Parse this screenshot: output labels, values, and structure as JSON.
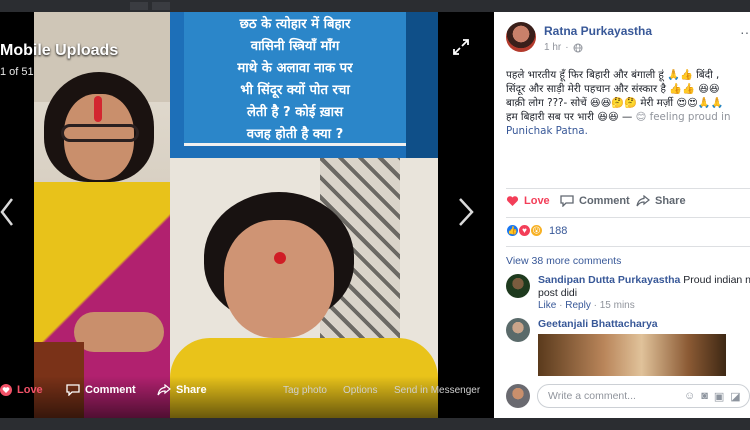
{
  "viewer": {
    "album_title": "Mobile Uploads",
    "counter": "1 of 51",
    "sign_lines": [
      "छठ के त्योहार में बिहार",
      "वासिनी स्त्रियाँ माँग",
      "माथे के अलावा नाक पर",
      "भी सिंदूर क्यों पोत रचा",
      "लेती है ? कोई ख़ास",
      "वजह होती है क्या ?"
    ],
    "actions": {
      "love": "Love",
      "comment": "Comment",
      "share": "Share"
    },
    "links": {
      "tag": "Tag photo",
      "options": "Options",
      "send": "Send in Messenger"
    }
  },
  "post": {
    "author": "Ratna Purkayastha",
    "time": "1 hr",
    "menu": "···",
    "text_lines": [
      "पहले भारतीय हूँ फिर बिहारी और बंगाली हूं 🙏👍 बिंदी ,",
      "सिंदूर और साड़ी मेरी पहचान और संस्कार है 👍👍 😆😆",
      "बाक़ी लोग ???- सोचें 😆😆🤔🤔 मेरी मर्ज़ी 😍😍🙏🙏",
      "हम बिहारी सब पर भारी 😆😆 —"
    ],
    "feeling": "😊 feeling proud in",
    "location": "Punichak Patna.",
    "actions": {
      "love": "Love",
      "comment": "Comment",
      "share": "Share"
    },
    "reaction_count": "188",
    "view_more": "View 38 more comments"
  },
  "comments": [
    {
      "name": "Sandipan Dutta Purkayastha",
      "text": "Proud indian nice",
      "text2": "post didi",
      "like": "Like",
      "reply": "Reply",
      "time": "15 mins"
    },
    {
      "name": "Geetanjali Bhattacharya"
    }
  ],
  "composer": {
    "placeholder": "Write a comment..."
  },
  "colors": {
    "link": "#385898",
    "love": "#f33e58",
    "text": "#1d2129",
    "muted": "#90949c"
  }
}
